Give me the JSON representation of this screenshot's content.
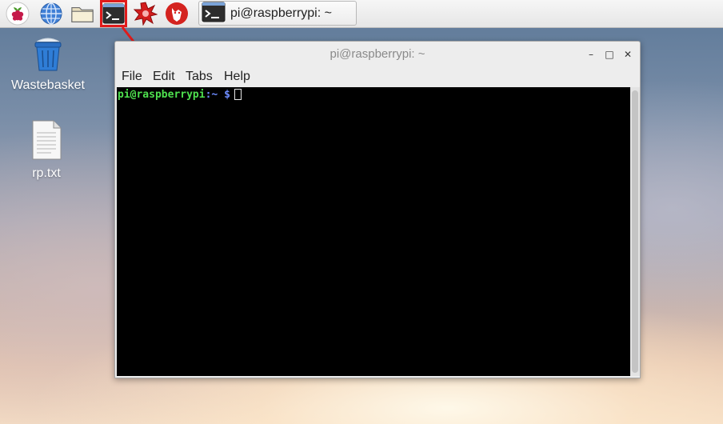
{
  "taskbar": {
    "launchers": [
      {
        "name": "raspberry-menu-icon"
      },
      {
        "name": "web-browser-icon"
      },
      {
        "name": "file-manager-icon"
      },
      {
        "name": "terminal-icon",
        "highlighted": true
      },
      {
        "name": "mathematica-icon"
      },
      {
        "name": "wolfram-icon"
      }
    ],
    "task": {
      "label": "pi@raspberrypi: ~",
      "icon": "terminal-icon"
    },
    "highlight_color": "#e01b1b"
  },
  "desktop": {
    "icons": [
      {
        "label": "Wastebasket",
        "icon": "trash-icon"
      },
      {
        "label": "rp.txt",
        "icon": "text-file-icon"
      }
    ]
  },
  "window": {
    "title": "pi@raspberrypi: ~",
    "controls": {
      "minimize": "–",
      "maximize": "□",
      "close": "✕"
    },
    "menu": [
      "File",
      "Edit",
      "Tabs",
      "Help"
    ],
    "terminal": {
      "prompt_user": "pi@raspberrypi",
      "prompt_sep": ":",
      "prompt_path": "~",
      "prompt_symbol": "$",
      "user_color": "#4ee04e",
      "path_color": "#6d8cff",
      "background": "#000000"
    }
  }
}
